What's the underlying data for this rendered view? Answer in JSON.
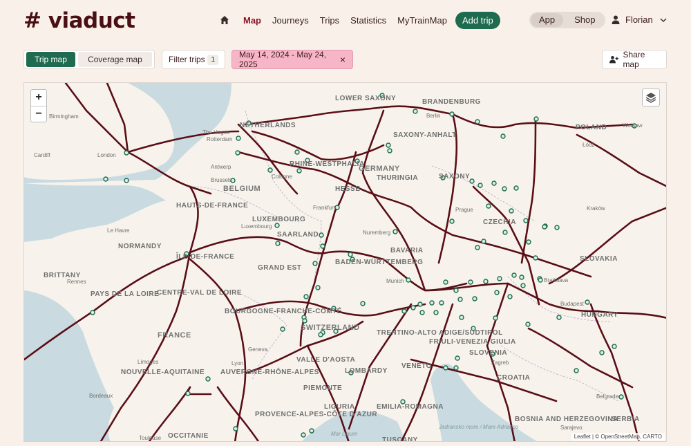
{
  "brand": {
    "logo": "# viaduct"
  },
  "nav": {
    "items": [
      {
        "label": "Map",
        "active": true
      },
      {
        "label": "Journeys",
        "active": false
      },
      {
        "label": "Trips",
        "active": false
      },
      {
        "label": "Statistics",
        "active": false
      },
      {
        "label": "MyTrainMap",
        "active": false
      }
    ],
    "add_trip": "Add trip",
    "segment": {
      "options": [
        "App",
        "Shop"
      ],
      "selected": "App"
    },
    "user": "Florian"
  },
  "toolbar": {
    "tabs": [
      {
        "label": "Trip map",
        "active": true
      },
      {
        "label": "Coverage map",
        "active": false
      }
    ],
    "filter_label": "Filter trips",
    "filter_count": "1",
    "date_range": "May 14, 2024 - May 24, 2025",
    "date_clear": "×",
    "share_label": "Share map"
  },
  "map": {
    "zoom_in": "+",
    "zoom_out": "−",
    "attribution": "Leaflet | © OpenStreetMap, CARTO",
    "colors": {
      "route": "#5a0e16",
      "station_fill": "#d7f0e2",
      "station_stroke": "#1e6b4f",
      "sea": "#c9dbe0",
      "land": "#f7f3ec"
    },
    "labels": {
      "countries": [
        "GERMANY",
        "BELGIUM",
        "LUXEMBOURG",
        "FRANCE",
        "SWITZERLAND",
        "CZECHIA",
        "SLOVAKIA",
        "POLAND",
        "CROATIA",
        "SERBIA",
        "BOSNIA AND HERZEGOVINA",
        "SLOVENIA"
      ],
      "regions": [
        "LOWER SAXONY",
        "BRANDENBURG",
        "SAXONY-ANHALT",
        "NETHERLANDS",
        "RHINE-WESTPHALIA",
        "HESSE",
        "THURINGIA",
        "SAXONY",
        "BAVARIA",
        "BADEN-WÜRTTEMBERG",
        "SAARLAND",
        "GRAND EST",
        "HAUTS-DE-FRANCE",
        "NORMANDY",
        "BRITTANY",
        "PAYS DE LA LOIRE",
        "CENTRE-VAL DE LOIRE",
        "BOURGOGNE-FRANCHE-COMTÉ",
        "NOUVELLE-AQUITAINE",
        "AUVERGNE-RHÔNE-ALPES",
        "PROVENCE-ALPES-CÔTE D'AZUR",
        "OCCITANIE",
        "VALLE D'AOSTA",
        "PIEMONTE",
        "LOMBARDY",
        "LIGURIA",
        "EMILIA-ROMAGNA",
        "VENETO",
        "TRENTINO-ALTO ADIGE/SÜDTIROL",
        "FRIULI-VENEZIA GIULIA",
        "TUSCANY",
        "HUNGARY",
        "ÎLE-DE-FRANCE"
      ],
      "cities": [
        "Birmingham",
        "Cardiff",
        "London",
        "The Hague",
        "Rotterdam",
        "Antwerp",
        "Brussels",
        "Luxembourg",
        "Le Havre",
        "Rennes",
        "Limoges",
        "Bordeaux",
        "Toulouse",
        "Lyon",
        "Geneva",
        "Munich",
        "Nuremberg",
        "Prague",
        "Berlin",
        "Łódź",
        "Kraków",
        "Bratislava",
        "Budapest",
        "Zagreb",
        "Sarajevo",
        "Belgrade",
        "Frankfurt",
        "Cologne",
        "Warsaw"
      ],
      "seas": [
        "Mar Ligure",
        "Jadransko more / Mare Adriatico"
      ]
    }
  }
}
